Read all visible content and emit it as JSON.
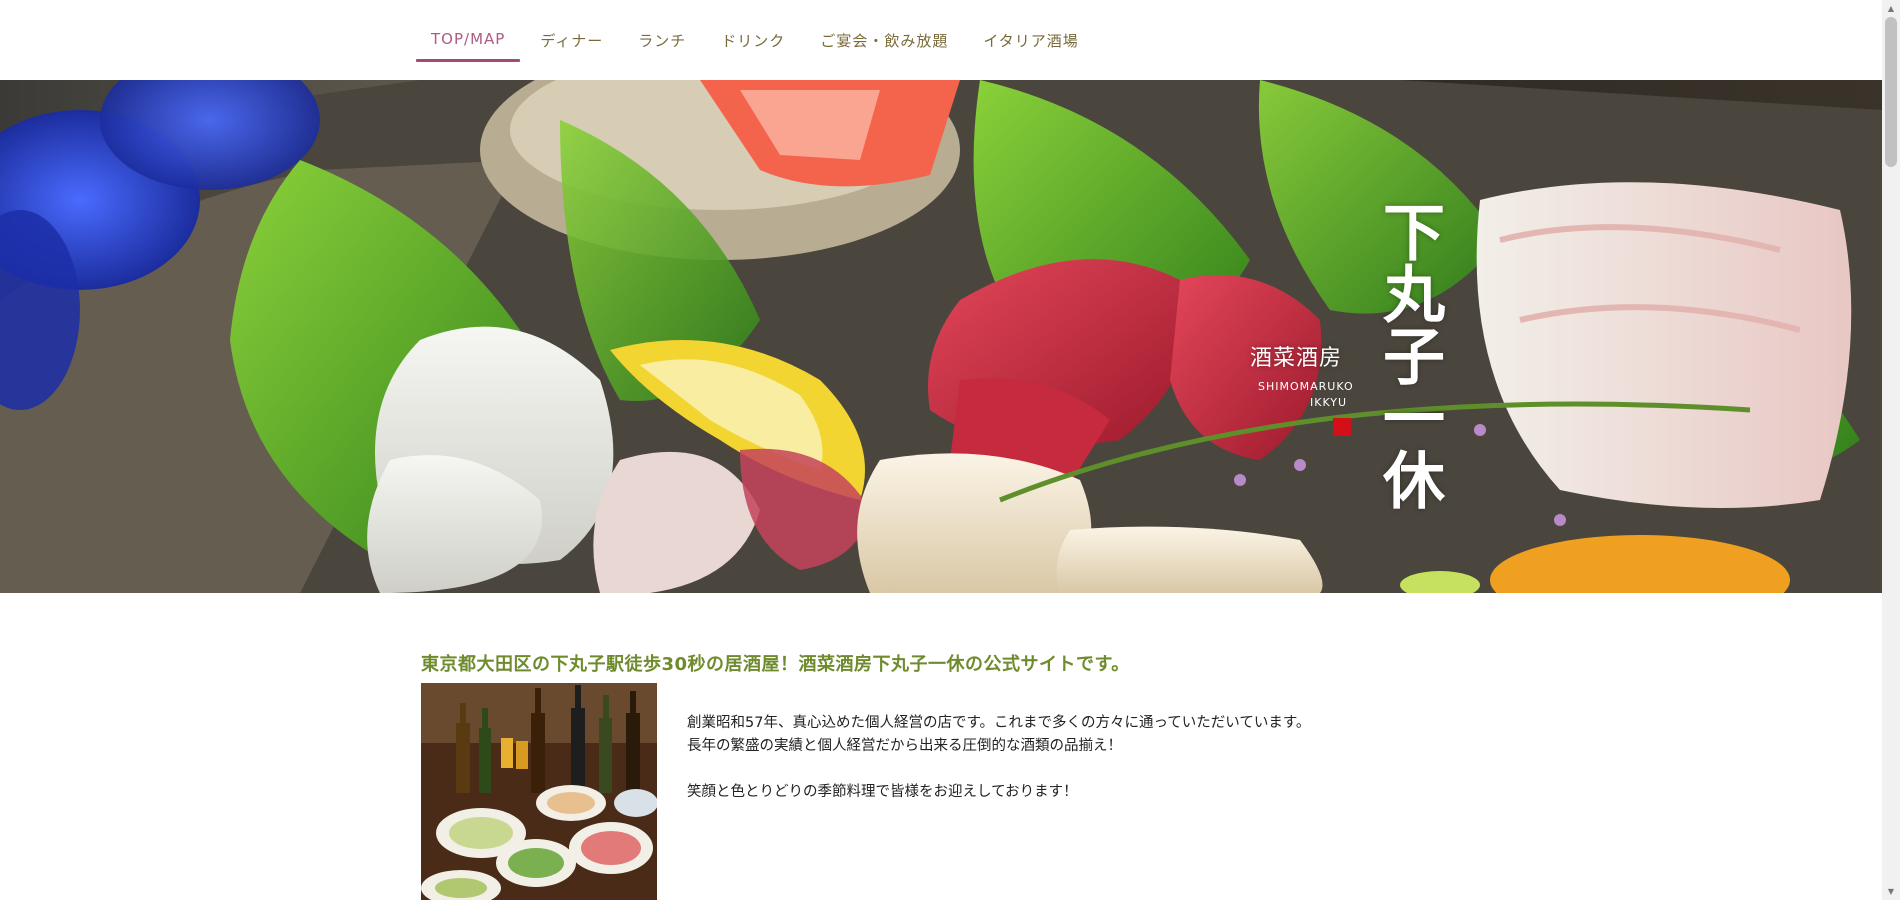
{
  "nav": {
    "items": [
      {
        "label": "TOP/MAP",
        "active": true
      },
      {
        "label": "ディナー"
      },
      {
        "label": "ランチ"
      },
      {
        "label": "ドリンク"
      },
      {
        "label": "ご宴会・飲み放題"
      },
      {
        "label": "イタリア酒場"
      }
    ]
  },
  "hero": {
    "logo_vertical": "下丸子一休",
    "logo_sub": "酒菜酒房",
    "logo_en_line1": "SHIMOMARUKO",
    "logo_en_line2": "IKKYU"
  },
  "intro": {
    "title": "東京都大田区の下丸子駅徒歩30秒の居酒屋！酒菜酒房下丸子一休の公式サイトです。",
    "line1": "創業昭和57年、真心込めた個人経営の店です。これまで多くの方々に通っていただいています。",
    "line2": "長年の繁盛の実績と個人経営だから出来る圧倒的な酒類の品揃え！",
    "line3": "笑顔と色とりどりの季節料理で皆様をお迎えしております！"
  },
  "colors": {
    "accent_nav_active": "#a54a78",
    "nav_text": "#7a6a3a",
    "intro_title": "#6f8b2d",
    "logo_seal": "#d40f18"
  }
}
